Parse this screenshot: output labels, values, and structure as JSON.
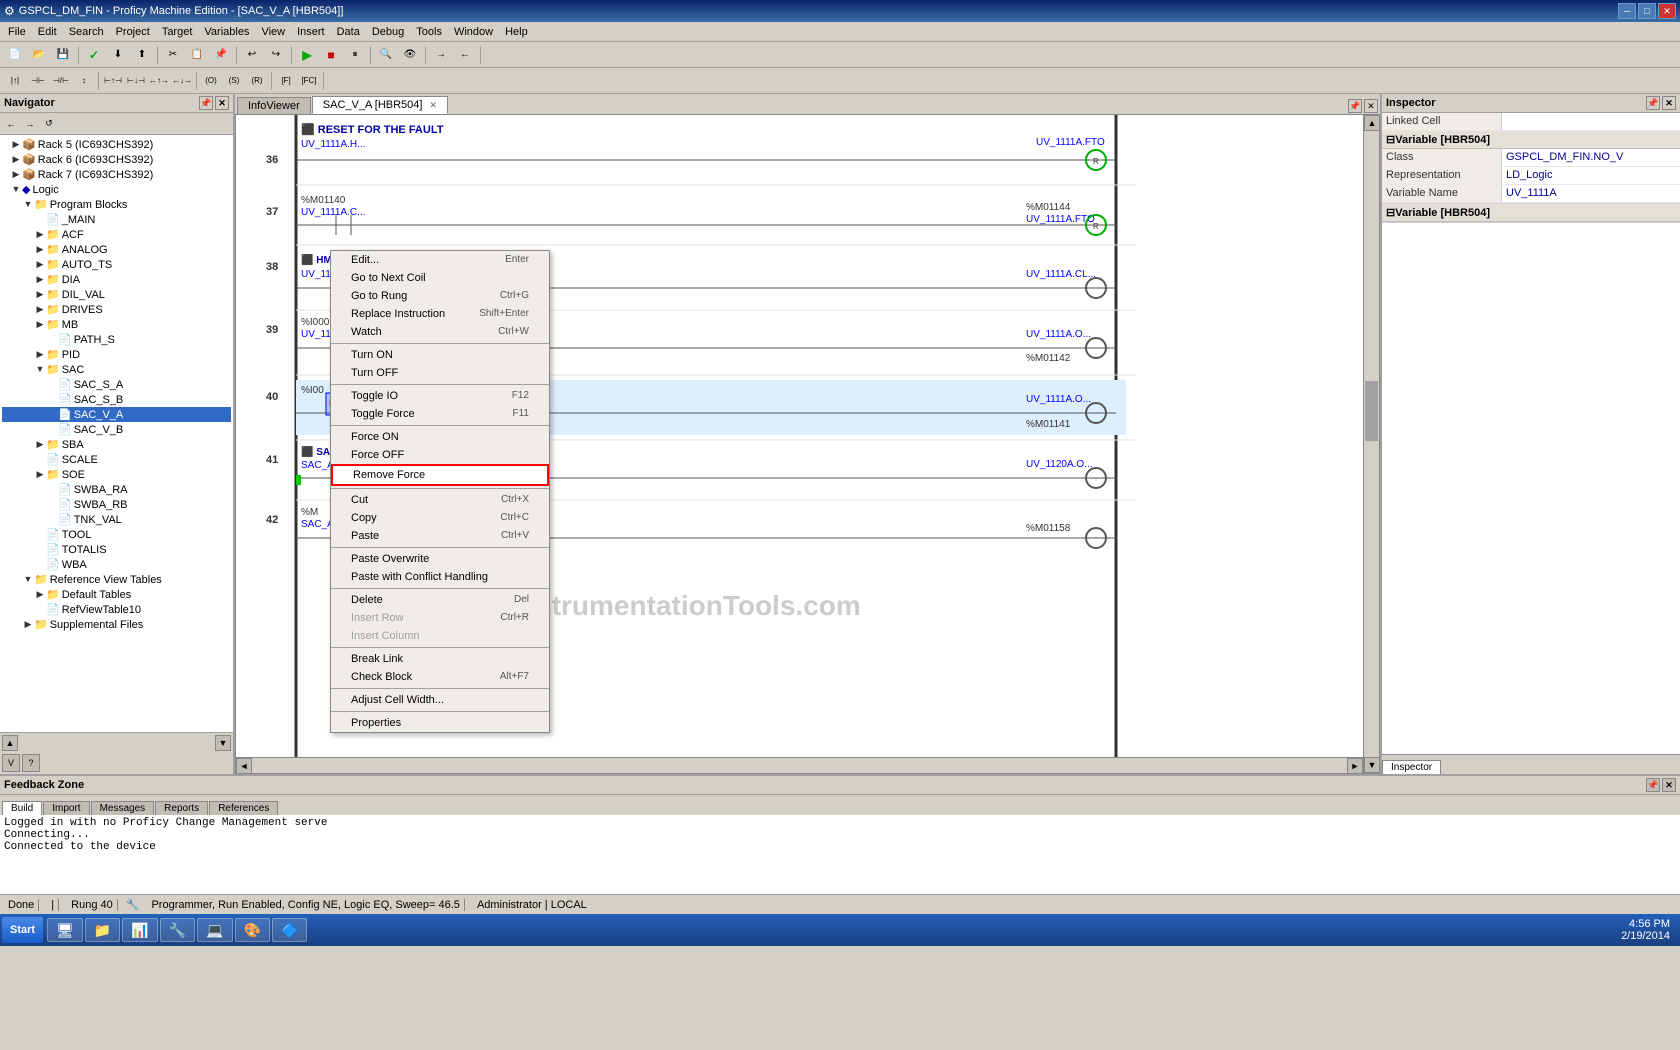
{
  "title_bar": {
    "title": "GSPCL_DM_FIN - Proficy Machine Edition - [SAC_V_A [HBR504]]",
    "icon": "⚙"
  },
  "menu": {
    "items": [
      "File",
      "Edit",
      "Search",
      "Project",
      "Target",
      "Variables",
      "View",
      "Insert",
      "Data",
      "Debug",
      "Tools",
      "Window",
      "Help"
    ]
  },
  "navigator": {
    "title": "Navigator",
    "tree": [
      {
        "label": "Rack 5 (IC693CHS392)",
        "level": 1,
        "expanded": true,
        "icon": "📦"
      },
      {
        "label": "Rack 6 (IC693CHS392)",
        "level": 1,
        "expanded": false,
        "icon": "📦"
      },
      {
        "label": "Rack 7 (IC693CHS392)",
        "level": 1,
        "expanded": false,
        "icon": "📦"
      },
      {
        "label": "Logic",
        "level": 1,
        "expanded": true,
        "icon": "🔷"
      },
      {
        "label": "Program Blocks",
        "level": 2,
        "expanded": true,
        "icon": "📁"
      },
      {
        "label": "_MAIN",
        "level": 3,
        "icon": "📄"
      },
      {
        "label": "ACF",
        "level": 3,
        "icon": "📁"
      },
      {
        "label": "ANALOG",
        "level": 3,
        "icon": "📁"
      },
      {
        "label": "AUTO_TS",
        "level": 3,
        "icon": "📁"
      },
      {
        "label": "DIA",
        "level": 3,
        "icon": "📁"
      },
      {
        "label": "DIL_VAL",
        "level": 3,
        "icon": "📁"
      },
      {
        "label": "DRIVES",
        "level": 3,
        "icon": "📁"
      },
      {
        "label": "MB",
        "level": 3,
        "icon": "📁"
      },
      {
        "label": "PATH_S",
        "level": 4,
        "icon": "📄"
      },
      {
        "label": "PID",
        "level": 3,
        "icon": "📁"
      },
      {
        "label": "SAC",
        "level": 3,
        "expanded": true,
        "icon": "📁"
      },
      {
        "label": "SAC_S_A",
        "level": 4,
        "icon": "📄"
      },
      {
        "label": "SAC_S_B",
        "level": 4,
        "icon": "📄"
      },
      {
        "label": "SAC_V_A",
        "level": 4,
        "icon": "📄",
        "selected": true
      },
      {
        "label": "SAC_V_B",
        "level": 4,
        "icon": "📄"
      },
      {
        "label": "SBA",
        "level": 3,
        "icon": "📁"
      },
      {
        "label": "SCALE",
        "level": 3,
        "icon": "📁"
      },
      {
        "label": "SOE",
        "level": 3,
        "icon": "📁"
      },
      {
        "label": "SWBA_RA",
        "level": 4,
        "icon": "📄"
      },
      {
        "label": "SWBA_RB",
        "level": 4,
        "icon": "📄"
      },
      {
        "label": "TNK_VAL",
        "level": 4,
        "icon": "📄"
      },
      {
        "label": "TOOL",
        "level": 3,
        "icon": "📁"
      },
      {
        "label": "TOTALIS",
        "level": 3,
        "icon": "📁"
      },
      {
        "label": "WBA",
        "level": 3,
        "icon": "📄"
      },
      {
        "label": "Reference View Tables",
        "level": 2,
        "expanded": true,
        "icon": "📁"
      },
      {
        "label": "Default Tables",
        "level": 3,
        "icon": "📁"
      },
      {
        "label": "RefViewTable10",
        "level": 3,
        "icon": "📄"
      },
      {
        "label": "Supplemental Files",
        "level": 2,
        "icon": "📁"
      }
    ]
  },
  "tabs": {
    "info_viewer": "InfoViewer",
    "sac_v_a": "SAC_V_A [HBR504]",
    "close_label": "×"
  },
  "ladder": {
    "rungs": [
      {
        "number": "36",
        "comment": "RESET FOR THE FAULT",
        "elements": [
          {
            "type": "contact",
            "var": "UV_1111A.H...",
            "addr": ""
          },
          {
            "type": "coil_right",
            "var": "UV_1111A.FTO",
            "addr": ""
          }
        ]
      },
      {
        "number": "37",
        "elements": [
          {
            "type": "contact",
            "var": "UV_1111A.C...",
            "addr": "%M01140"
          },
          {
            "type": "coil_right",
            "var": "UV_1111A.FTO",
            "addr": "%M01144"
          }
        ]
      },
      {
        "number": "38",
        "comment": "HMI STATUS OPEN\\CLOSE FEEDBACK",
        "elements": [
          {
            "type": "contact",
            "var": "UV_1111A.CLS_...",
            "addr": ""
          },
          {
            "type": "coil_right",
            "var": "UV_1111A.CL...",
            "addr": ""
          }
        ]
      },
      {
        "number": "39",
        "elements": [
          {
            "type": "contact_selected",
            "var": "UV_1111",
            "addr": "%I00050"
          },
          {
            "type": "coil_right",
            "var": "UV_1111A.O...",
            "addr": "%M01142"
          }
        ]
      },
      {
        "number": "40",
        "elements": [
          {
            "type": "contact",
            "var": "",
            "addr": "%I00"
          },
          {
            "type": "coil_right",
            "var": "UV_1111A.O...",
            "addr": "%M01141"
          }
        ]
      },
      {
        "number": "41",
        "comment": "SAC-",
        "elements": [
          {
            "type": "contact",
            "var": "SAC_A",
            "addr": ""
          },
          {
            "type": "coil_right",
            "var": "UV_1120A.O...",
            "addr": ""
          }
        ]
      },
      {
        "number": "42",
        "elements": [
          {
            "type": "contact",
            "var": "SAC_A",
            "addr": "%M"
          },
          {
            "type": "coil_right",
            "var": "",
            "addr": "%M01158"
          }
        ]
      }
    ]
  },
  "context_menu": {
    "items": [
      {
        "label": "Edit...",
        "shortcut": "Enter",
        "enabled": true
      },
      {
        "label": "Go to Next Coil",
        "shortcut": "",
        "enabled": true
      },
      {
        "label": "Go to Rung",
        "shortcut": "Ctrl+G",
        "enabled": true
      },
      {
        "label": "Replace Instruction",
        "shortcut": "Shift+Enter",
        "enabled": true
      },
      {
        "label": "Watch",
        "shortcut": "Ctrl+W",
        "enabled": true
      },
      {
        "separator": true
      },
      {
        "label": "Turn ON",
        "shortcut": "",
        "enabled": true
      },
      {
        "label": "Turn OFF",
        "shortcut": "",
        "enabled": true
      },
      {
        "separator": true
      },
      {
        "label": "Toggle IO",
        "shortcut": "F12",
        "enabled": true
      },
      {
        "label": "Toggle Force",
        "shortcut": "F11",
        "enabled": true
      },
      {
        "separator": true
      },
      {
        "label": "Force ON",
        "shortcut": "",
        "enabled": true
      },
      {
        "label": "Force OFF",
        "shortcut": "",
        "enabled": true
      },
      {
        "label": "Remove Force",
        "shortcut": "",
        "enabled": true,
        "highlighted": true
      },
      {
        "separator": true
      },
      {
        "label": "Cut",
        "shortcut": "Ctrl+X",
        "enabled": true
      },
      {
        "label": "Copy",
        "shortcut": "Ctrl+C",
        "enabled": true
      },
      {
        "label": "Paste",
        "shortcut": "Ctrl+V",
        "enabled": true
      },
      {
        "separator": true
      },
      {
        "label": "Paste Overwrite",
        "shortcut": "",
        "enabled": true
      },
      {
        "label": "Paste with Conflict Handling",
        "shortcut": "",
        "enabled": true
      },
      {
        "separator": true
      },
      {
        "label": "Delete",
        "shortcut": "Del",
        "enabled": true
      },
      {
        "label": "Insert Row",
        "shortcut": "Ctrl+R",
        "enabled": false
      },
      {
        "label": "Insert Column",
        "shortcut": "",
        "enabled": false
      },
      {
        "separator": true
      },
      {
        "label": "Break Link",
        "shortcut": "",
        "enabled": true
      },
      {
        "label": "Check Block",
        "shortcut": "Alt+F7",
        "enabled": true
      },
      {
        "separator": true
      },
      {
        "label": "Adjust Cell Width...",
        "shortcut": "",
        "enabled": true
      },
      {
        "separator": true
      },
      {
        "label": "Properties",
        "shortcut": "",
        "enabled": true
      }
    ]
  },
  "inspector": {
    "title": "Inspector",
    "linked_cell_label": "Linked Cell",
    "linked_cell_value": "",
    "sections": [
      {
        "title": "⊟Variable [HBR504]",
        "rows": [
          {
            "label": "Class",
            "value": "GSPCL_DM_FIN.NO_V"
          },
          {
            "label": "Representation",
            "value": "LD_Logic"
          },
          {
            "label": "Variable Name",
            "value": "UV_1111A"
          }
        ]
      },
      {
        "title": "⊟Variable [HBR504]",
        "rows": []
      }
    ]
  },
  "feedback": {
    "title": "Feedback Zone",
    "lines": [
      "Logged in with no Proficy Change Management serve",
      "Connecting...",
      "Connected to the device"
    ]
  },
  "bottom_tabs": {
    "items": [
      "Build",
      "Import",
      "Messages",
      "Reports",
      "References"
    ]
  },
  "status_bar": {
    "left": "Done",
    "rung": "Rung 40",
    "mode": "Programmer, Run Enabled, Config NE, Logic EQ, Sweep= 46.5",
    "user": "Administrator | LOCAL"
  },
  "taskbar": {
    "time": "4:56 PM",
    "date": "2/19/2014",
    "start_label": "Start",
    "items": [
      {
        "icon": "🖥",
        "label": ""
      },
      {
        "icon": "📁",
        "label": ""
      },
      {
        "icon": "📊",
        "label": ""
      },
      {
        "icon": "🔧",
        "label": ""
      },
      {
        "icon": "💻",
        "label": ""
      },
      {
        "icon": "🎨",
        "label": ""
      },
      {
        "icon": "🔷",
        "label": ""
      }
    ]
  },
  "watermark": "InstrumentationTools.com",
  "inspector_bottom_tab": "Inspector"
}
